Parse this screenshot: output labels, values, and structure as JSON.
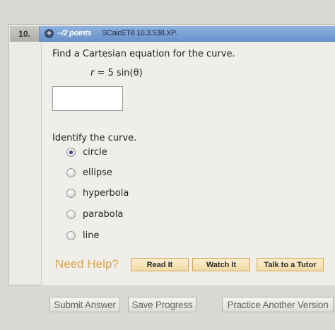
{
  "question": {
    "number": "10.",
    "points": "–/2 points",
    "source": "SCalcET8 10.3.538.XP.",
    "prompt": "Find a Cartesian equation for the curve.",
    "equation_lhs": "r",
    "equation_rhs": " = 5 sin(θ)",
    "answer_value": "",
    "identify_label": "Identify the curve.",
    "options": [
      {
        "label": "circle",
        "selected": true
      },
      {
        "label": "ellipse",
        "selected": false
      },
      {
        "label": "hyperbola",
        "selected": false
      },
      {
        "label": "parabola",
        "selected": false
      },
      {
        "label": "line",
        "selected": false
      }
    ]
  },
  "help": {
    "label": "Need Help?",
    "read_it": "Read It",
    "watch_it": "Watch It",
    "talk_to_tutor": "Talk to a Tutor"
  },
  "footer": {
    "submit": "Submit Answer",
    "save": "Save Progress",
    "practice": "Practice Another Version"
  },
  "colors": {
    "header_blue": "#6a93cc",
    "help_orange": "#e0a44a",
    "button_gold": "#f1d9a5"
  }
}
